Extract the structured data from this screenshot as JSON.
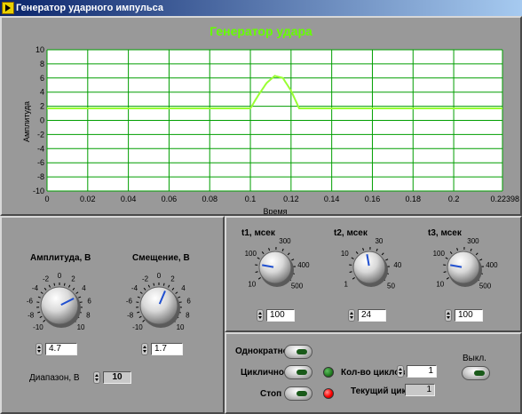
{
  "window": {
    "title": "Генератор ударного импульса"
  },
  "chart": {
    "title": "Генератор удара",
    "xlabel": "Время",
    "ylabel": "Амплитуда",
    "x_ticks": [
      "0",
      "0.02",
      "0.04",
      "0.06",
      "0.08",
      "0.1",
      "0.12",
      "0.14",
      "0.16",
      "0.18",
      "0.2",
      "0.22398"
    ],
    "y_ticks": [
      "10",
      "8",
      "6",
      "4",
      "2",
      "0",
      "-2",
      "-4",
      "-6",
      "-8",
      "-10"
    ]
  },
  "chart_data": {
    "type": "line",
    "title": "Генератор удара",
    "xlabel": "Время",
    "ylabel": "Амплитуда",
    "xlim": [
      0,
      0.22398
    ],
    "ylim": [
      -10,
      10
    ],
    "grid": true,
    "series": [
      {
        "x": [
          0,
          0.1,
          0.104,
          0.108,
          0.112,
          0.116,
          0.12,
          0.124,
          0.22398
        ],
        "y": [
          1.7,
          1.7,
          3.6,
          5.3,
          6.3,
          6.0,
          4.2,
          1.7,
          1.7
        ]
      }
    ]
  },
  "amplitude": {
    "label": "Амплитуда, В",
    "value": "4.7",
    "ticks": [
      "-10",
      "-8",
      "-6",
      "-4",
      "-2",
      "0",
      "2",
      "4",
      "6",
      "8",
      "10"
    ],
    "knob_value": 4.7
  },
  "offset": {
    "label": "Смещение, В",
    "value": "1.7",
    "ticks": [
      "-10",
      "-8",
      "-6",
      "-4",
      "-2",
      "0",
      "2",
      "4",
      "6",
      "8",
      "10"
    ],
    "knob_value": 1.7
  },
  "range": {
    "label": "Диапазон, В",
    "value": "10"
  },
  "t1": {
    "label": "t1, мсек",
    "value": "100",
    "ticks": [
      "10",
      "100",
      "300",
      "400",
      "500"
    ]
  },
  "t2": {
    "label": "t2, мсек",
    "value": "24",
    "ticks": [
      "1",
      "10",
      "30",
      "40",
      "50"
    ]
  },
  "t3": {
    "label": "t3, мсек",
    "value": "100",
    "ticks": [
      "10",
      "100",
      "300",
      "400",
      "500"
    ]
  },
  "controls": {
    "once_label": "Однократно",
    "cyclic_label": "Циклично",
    "stop_label": "Стоп",
    "cycles_label": "Кол-во циклов",
    "cycles_value": "1",
    "current_label": "Текущий цикл",
    "current_value": "1",
    "off_label": "Выкл."
  },
  "colors": {
    "plot_bg": "#ffffff",
    "grid": "#009e00",
    "trace": "#99ff33",
    "title": "#66ff00",
    "led_green": "#1f7a1f",
    "led_red": "#ff0000"
  }
}
